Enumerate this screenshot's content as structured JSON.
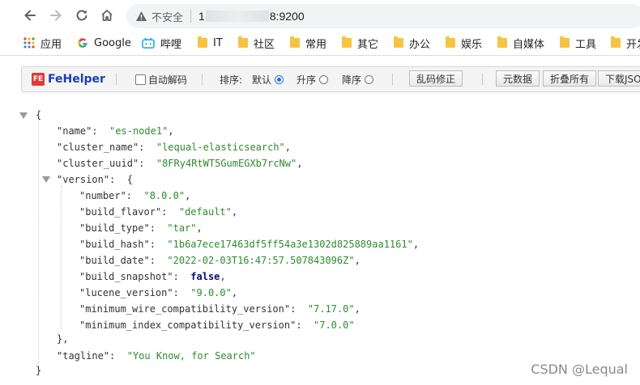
{
  "browser": {
    "security_label": "不安全",
    "url_prefix": "1",
    "url_suffix": "8:9200"
  },
  "bookmarks": [
    {
      "label": "应用",
      "icon": "apps-grid-icon"
    },
    {
      "label": "Google",
      "icon": "google-icon"
    },
    {
      "label": "哔哩",
      "icon": "bilibili-icon"
    },
    {
      "label": "IT",
      "icon": "folder-icon"
    },
    {
      "label": "社区",
      "icon": "folder-icon"
    },
    {
      "label": "常用",
      "icon": "folder-icon"
    },
    {
      "label": "其它",
      "icon": "folder-icon"
    },
    {
      "label": "办公",
      "icon": "folder-icon"
    },
    {
      "label": "娱乐",
      "icon": "folder-icon"
    },
    {
      "label": "自媒体",
      "icon": "folder-icon"
    },
    {
      "label": "工具",
      "icon": "folder-icon"
    },
    {
      "label": "开发",
      "icon": "folder-icon"
    }
  ],
  "fehelper": {
    "logo_badge": "FE",
    "logo_text": "FeHelper",
    "auto_decode": "自动解码",
    "sort_label": "排序:",
    "sort_options": [
      {
        "label": "默认",
        "selected": true
      },
      {
        "label": "升序",
        "selected": false
      },
      {
        "label": "降序",
        "selected": false
      }
    ],
    "fix_encoding": "乱码修正",
    "buttons": [
      "元数据",
      "折叠所有",
      "下载JSON"
    ]
  },
  "json": {
    "open_brace": "{",
    "close_brace": "}",
    "name_key": "\"name\"",
    "name_val": "\"es-node1\"",
    "cluster_name_key": "\"cluster_name\"",
    "cluster_name_val": "\"lequal-elasticsearch\"",
    "cluster_uuid_key": "\"cluster_uuid\"",
    "cluster_uuid_val": "\"8FRy4RtWT5GumEGXb7rcNw\"",
    "version_key": "\"version\"",
    "number_key": "\"number\"",
    "number_val": "\"8.0.0\"",
    "build_flavor_key": "\"build_flavor\"",
    "build_flavor_val": "\"default\"",
    "build_type_key": "\"build_type\"",
    "build_type_val": "\"tar\"",
    "build_hash_key": "\"build_hash\"",
    "build_hash_val": "\"1b6a7ece17463df5ff54a3e1302d825889aa1161\"",
    "build_date_key": "\"build_date\"",
    "build_date_val": "\"2022-02-03T16:47:57.507843096Z\"",
    "build_snapshot_key": "\"build_snapshot\"",
    "build_snapshot_val": "false",
    "lucene_version_key": "\"lucene_version\"",
    "lucene_version_val": "\"9.0.0\"",
    "min_wire_key": "\"minimum_wire_compatibility_version\"",
    "min_wire_val": "\"7.17.0\"",
    "min_index_key": "\"minimum_index_compatibility_version\"",
    "min_index_val": "\"7.0.0\"",
    "version_close": "},",
    "tagline_key": "\"tagline\"",
    "tagline_val": "\"You Know, for Search\""
  },
  "watermark": "CSDN @Lequal",
  "colors": {
    "string": "#2e8b2e",
    "boolean": "#0b0b7e",
    "fehelper_brand": "#1a3fb5",
    "fehelper_badge": "#e53935",
    "folder": "#f6c344"
  }
}
